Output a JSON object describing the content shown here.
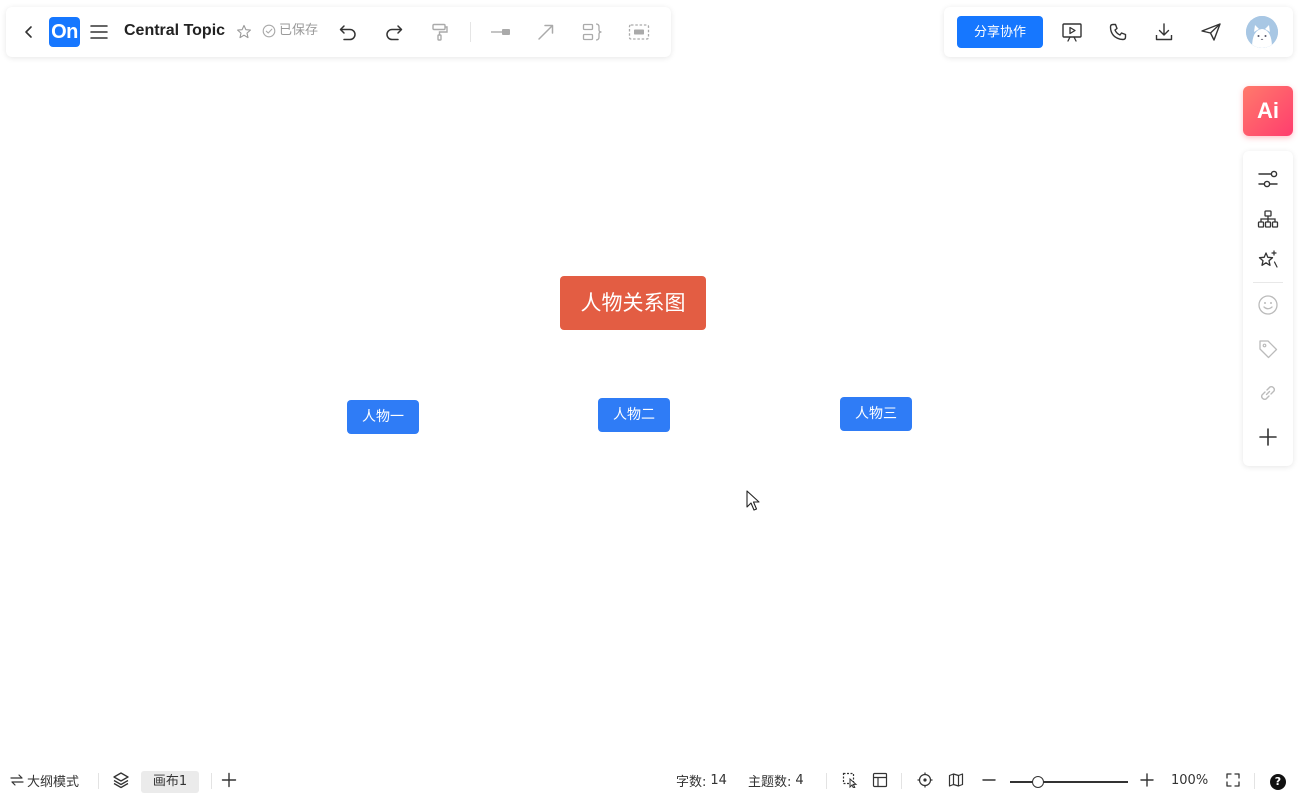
{
  "toolbar": {
    "logo_text": "On",
    "title": "Central Topic",
    "saved_status": "已保存"
  },
  "share": {
    "label": "分享协作"
  },
  "ai": {
    "label": "Ai"
  },
  "mindmap": {
    "central": "人物关系图",
    "children": [
      "人物一",
      "人物二",
      "人物三"
    ]
  },
  "bottom": {
    "outline_mode": "大纲模式",
    "canvas_tab": "画布1",
    "word_count_label": "字数:",
    "word_count": "14",
    "topic_count_label": "主题数:",
    "topic_count": "4",
    "zoom": "100%",
    "help": "?"
  },
  "colors": {
    "accent": "#1677ff",
    "central_node": "#e35d43",
    "child_node": "#2f7cf6"
  }
}
